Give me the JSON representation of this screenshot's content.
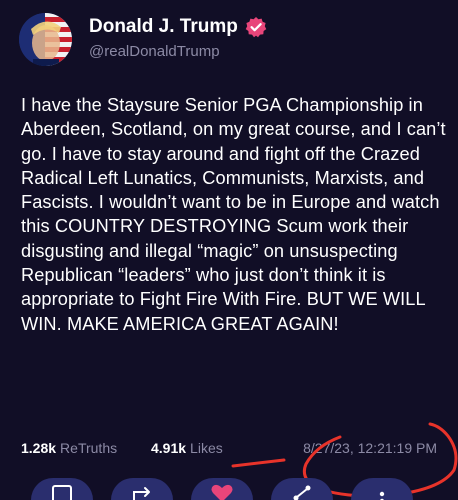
{
  "post": {
    "author": {
      "display_name": "Donald J. Trump",
      "handle": "@realDonaldTrump",
      "verified": true,
      "verified_color": "#e8457a"
    },
    "text": "I have the Staysure Senior PGA Championship in Aberdeen, Scotland, on my great course, and I can’t go. I have to stay around and fight off the Crazed Radical Left Lunatics, Communists, Marxists, and Fascists. I wouldn’t want to be in Europe and watch this COUNTRY DESTROYING Scum work their disgusting and illegal “magic” on unsuspecting Republican “leaders” who just don’t think it is appropriate to Fight Fire With Fire. BUT WE WILL WIN. MAKE AMERICA GREAT AGAIN!",
    "stats": {
      "retruths_count": "1.28k",
      "retruths_label": "ReTruths",
      "likes_count": "4.91k",
      "likes_label": "Likes"
    },
    "timestamp": "8/27/23, 12:21:19 PM"
  },
  "actions": [
    {
      "name": "reply",
      "icon": "reply-icon"
    },
    {
      "name": "retruth",
      "icon": "retruth-icon"
    },
    {
      "name": "like",
      "icon": "heart-icon"
    },
    {
      "name": "share",
      "icon": "share-icon"
    },
    {
      "name": "more",
      "icon": "more-icon"
    }
  ],
  "colors": {
    "background": "#110e26",
    "text": "#ffffff",
    "muted": "#8c8aa5",
    "action_button": "#2a2e6e",
    "like_active": "#e8457a",
    "annotation_red": "#e8332a"
  }
}
